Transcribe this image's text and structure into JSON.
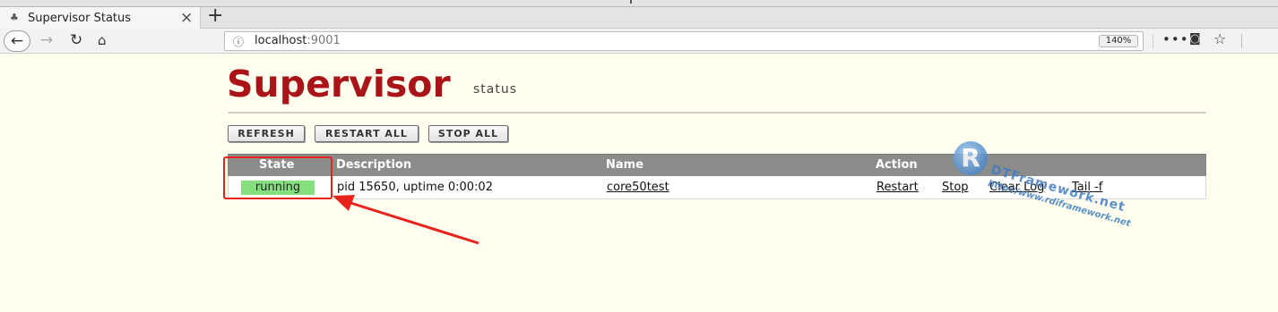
{
  "browser": {
    "tab_title": "Supervisor Status",
    "tab_close": "×",
    "new_tab": "+",
    "url_host": "localhost",
    "url_port": ":9001",
    "zoom": "140%",
    "page_actions": "•••"
  },
  "page": {
    "logo": "Supervisor",
    "logo_sub": "status",
    "buttons": {
      "refresh": "REFRESH",
      "restart_all": "RESTART ALL",
      "stop_all": "STOP ALL"
    },
    "table": {
      "headers": {
        "state": "State",
        "description": "Description",
        "name": "Name",
        "action": "Action"
      },
      "rows": [
        {
          "state": "running",
          "description": "pid 15650, uptime 0:00:02",
          "name": "core50test",
          "actions": [
            "Restart",
            "Stop",
            "Clear Log",
            "Tail -f"
          ]
        }
      ]
    }
  },
  "watermark": {
    "letter": "R",
    "text": "DTFramework.net",
    "url": "http://www.rdiframework.net"
  },
  "colors": {
    "logo_red": "#a81418",
    "running_green": "#84e07e",
    "header_gray": "#8c8c8a",
    "annotation_red": "#e8231c",
    "page_bg": "#fffeef"
  },
  "icons": {
    "favicon": "supervisor-favicon-icon",
    "back": "back-arrow-icon",
    "forward": "forward-arrow-icon",
    "reload": "reload-icon",
    "home": "home-icon",
    "info": "info-icon",
    "pocket": "pocket-icon",
    "bookmark": "star-icon"
  }
}
